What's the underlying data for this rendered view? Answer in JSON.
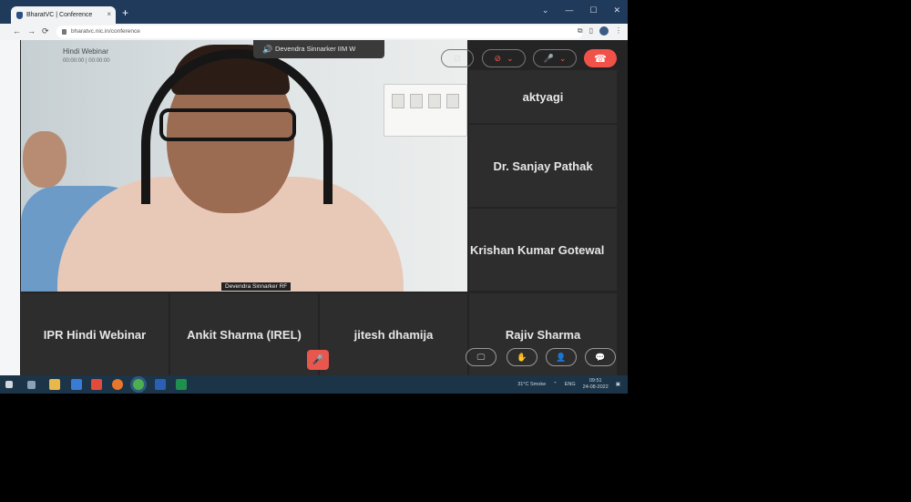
{
  "browser": {
    "tab_title": "BharatVC | Conference",
    "tab_close": "×",
    "new_tab": "+",
    "url": "bharatvc.nic.in/conference",
    "window_controls": [
      "⌄",
      "—",
      "☐",
      "✕"
    ]
  },
  "webinar": {
    "title": "Hindi Webinar",
    "subtitle": "00:00:00 | 00:00:00"
  },
  "speaker": {
    "chip_label": "Devendra Sinnarker IIM W",
    "name_tag": "Devendra Sinnarker RF"
  },
  "participants": [
    {
      "name": "aktyagi"
    },
    {
      "name": "Dr. Sanjay Pathak"
    },
    {
      "name": "Krishan Kumar Gotewal"
    },
    {
      "name": "IPR Hindi Webinar"
    },
    {
      "name": "Ankit Sharma (IREL)"
    },
    {
      "name": "jitesh dhamija"
    },
    {
      "name": "Rajiv Sharma"
    }
  ],
  "icons": {
    "screen_share": "⊡",
    "video_off": "⊘",
    "mic_off": "🎤",
    "leave": "☎",
    "chevron": "⌄",
    "monitor": "🖵",
    "hand": "✋",
    "people": "👤",
    "chat": "💬",
    "volume": "🔊",
    "menu": "⋮"
  },
  "taskbar": {
    "weather": "31°C  Smoke",
    "lang": "ENG",
    "time": "09:51",
    "date": "24-08-2022"
  },
  "colors": {
    "leave_red": "#f0524a",
    "tile_bg": "#2d2d2d",
    "taskbar": "#1c3447",
    "tabbar": "#1f3a5a"
  }
}
